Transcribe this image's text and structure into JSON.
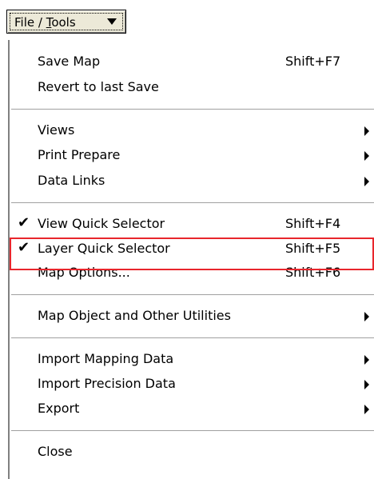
{
  "menu_button": {
    "label_prefix": "File / ",
    "label_accel": "T",
    "label_suffix": "ools"
  },
  "menu": {
    "items": [
      {
        "label": "Save Map",
        "shortcut": "Shift+F7"
      },
      {
        "label": "Revert to last Save",
        "shortcut": ""
      },
      {
        "label": "Views",
        "shortcut": "",
        "submenu": true
      },
      {
        "label": "Print Prepare",
        "shortcut": "",
        "submenu": true
      },
      {
        "label": "Data Links",
        "shortcut": "",
        "submenu": true
      },
      {
        "label": "View Quick Selector",
        "shortcut": "Shift+F4",
        "checked": true
      },
      {
        "label": "Layer Quick Selector",
        "shortcut": "Shift+F5",
        "checked": true,
        "highlighted": true
      },
      {
        "label": "Map Options...",
        "shortcut": "Shift+F6"
      },
      {
        "label": "Map Object and Other Utilities",
        "shortcut": "",
        "submenu": true
      },
      {
        "label": "Import Mapping Data",
        "shortcut": "",
        "submenu": true
      },
      {
        "label": "Import Precision Data",
        "shortcut": "",
        "submenu": true
      },
      {
        "label": "Export",
        "shortcut": "",
        "submenu": true
      },
      {
        "label": "Close",
        "shortcut": ""
      }
    ]
  },
  "icons": {
    "check": "check-icon",
    "submenu": "submenu-arrow-icon",
    "dropdown": "dropdown-icon"
  },
  "colors": {
    "highlight_box": "#e8262c",
    "button_face": "#ece9d8"
  }
}
